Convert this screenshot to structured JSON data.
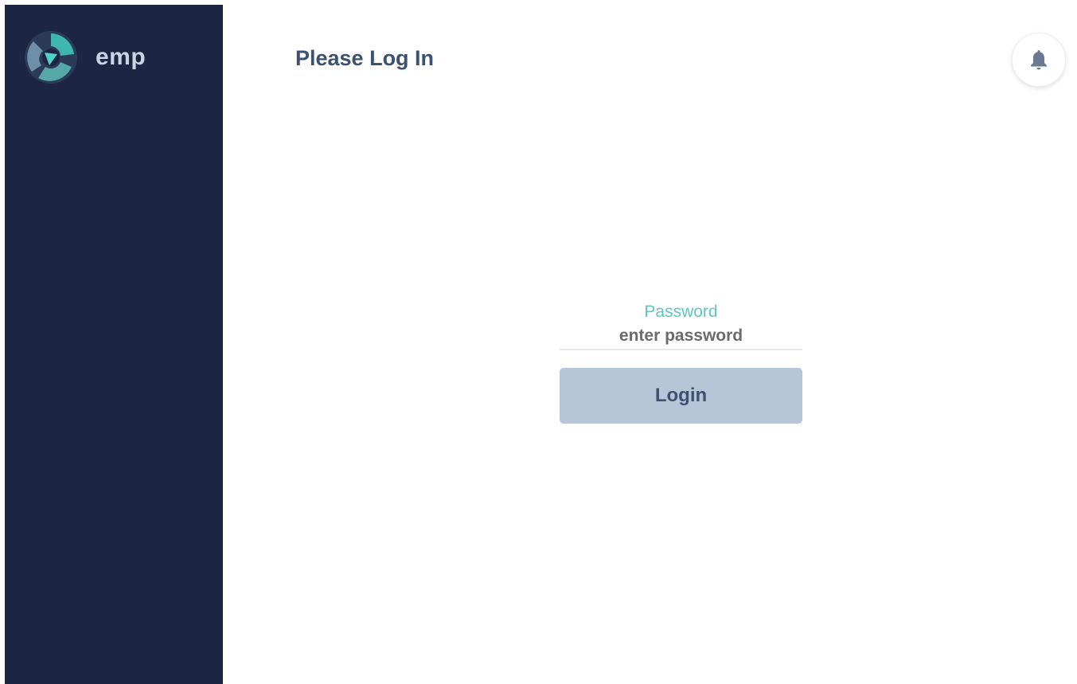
{
  "app": {
    "brand_name": "emp",
    "logo_icon": "emp-logo-icon"
  },
  "header": {
    "title": "Please Log In",
    "notification_icon": "bell-icon"
  },
  "login_form": {
    "password_label": "Password",
    "password_placeholder": "enter password",
    "password_value": "",
    "login_button_label": "Login"
  },
  "colors": {
    "sidebar_bg": "#1c2541",
    "accent_teal": "#5fc4c4",
    "button_bg": "#b6c5d8",
    "title_text": "#3d5170"
  }
}
